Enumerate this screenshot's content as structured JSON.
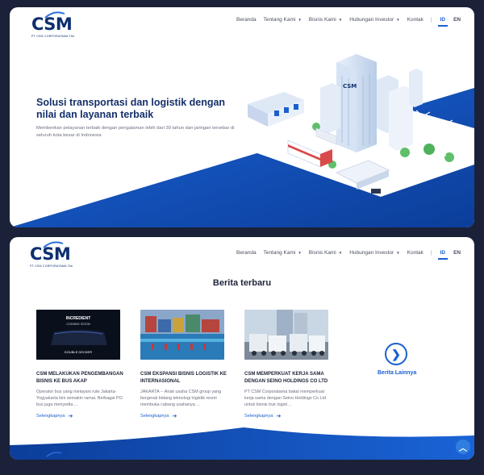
{
  "brand": {
    "name": "CSM",
    "tagline": "PT CSM CORPORATAMA Tbk"
  },
  "nav": {
    "items": [
      {
        "label": "Beranda",
        "dropdown": false
      },
      {
        "label": "Tentang Kami",
        "dropdown": true
      },
      {
        "label": "Bisnis Kami",
        "dropdown": true
      },
      {
        "label": "Hubungan Investor",
        "dropdown": true
      },
      {
        "label": "Kontak",
        "dropdown": false
      }
    ],
    "separator": "|",
    "lang_id": "ID",
    "lang_en": "EN"
  },
  "hero": {
    "title": "Solusi transportasi dan logistik dengan nilai dan layanan terbaik",
    "subtitle": "Memberikan pelayanan terbaik dengan pengalaman lebih dari 30 tahun dan jaringan tersebar di seluruh kota besar di Indonesia",
    "building_logo": "CSM"
  },
  "news": {
    "section_title": "Berita terbaru",
    "cards": [
      {
        "title": "CSM MELAKUKAN PENGEMBANGAN BISNIS KE BUS AKAP",
        "desc": "Operator bus yang melayani rute Jakarta-Yogyakarta kini semakin ramai. Berbagai PO bus juga menyedia ...",
        "more": "Selengkapnya",
        "thumb_line1": "INCREDIENT",
        "thumb_line2": "COMING SOON",
        "thumb_line3": "DOUBLE DECKER"
      },
      {
        "title": "CSM EKSPANSI BISNIS LOGISTIK KE INTERNASIONAL",
        "desc": "JAKARTA -- Anak usaha CSM group yang bergerak bidang teknologi logistik resmi membuka cabang usahanya ...",
        "more": "Selengkapnya"
      },
      {
        "title": "CSM MEMPERKUAT KERJA SAMA DENGAN SEINO HOLDINGS CO LTD",
        "desc": "PT CSM Corporatama bakal memperkuat kerja sama dengan Seino Holdings Co Ltd untuk bisnis truk logist ...",
        "more": "Selengkapnya"
      }
    ],
    "more_label": "Berita Lainnya"
  },
  "icons": {
    "more": "chevron-right-icon",
    "scroll_top": "chevron-up-icon",
    "arrow": "arrow-right-icon"
  },
  "colors": {
    "primary_blue": "#1a5fd0",
    "navy": "#15306a",
    "frame": "#1b2138"
  }
}
